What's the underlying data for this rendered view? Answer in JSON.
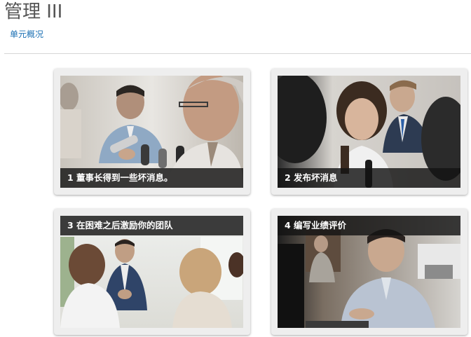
{
  "header": {
    "title": "管理 III",
    "unit_link": "单元概况"
  },
  "cards": [
    {
      "caption": "1 董事长得到一些坏消息。",
      "image": "photo-press-interview"
    },
    {
      "caption": "2 发布坏消息",
      "image": "photo-announcement"
    },
    {
      "caption": "3 在困难之后激励你的团队",
      "image": "photo-team-meeting"
    },
    {
      "caption": "4 编写业绩评价",
      "image": "photo-office-worker"
    }
  ]
}
